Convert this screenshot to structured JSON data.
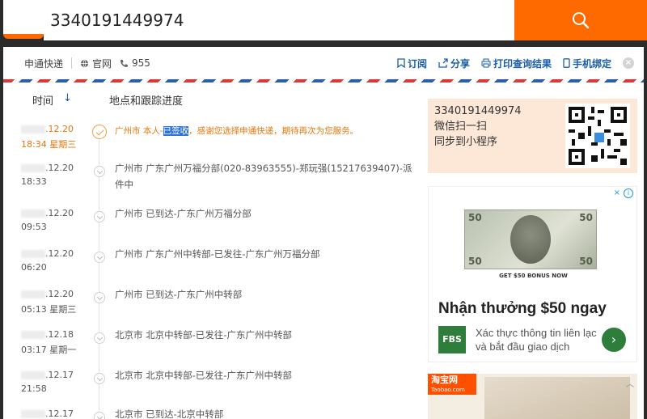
{
  "search": {
    "value": "3340191449974",
    "icon": "search-icon"
  },
  "toolbar": {
    "carrier": "申通快递",
    "website": "官网",
    "phone": "955",
    "actions": [
      {
        "label": "订阅",
        "icon": "bookmark-icon"
      },
      {
        "label": "分享",
        "icon": "share-icon"
      },
      {
        "label": "打印查询结果",
        "icon": "print-icon"
      },
      {
        "label": "手机绑定",
        "icon": "phone-icon"
      }
    ]
  },
  "timeline": {
    "header_time": "时间",
    "header_sort": "↓",
    "header_location": "地点和跟踪进度",
    "rows": [
      {
        "date": ".12.20",
        "time": "18:34 星期三",
        "status_prefix": "广州市 本人-",
        "status_highlight": "已签收",
        "status_suffix": "，感谢您选择申通快递，期待再次为您服务。"
      },
      {
        "date": ".12.20",
        "time": "18:33",
        "status": "广州市 广东广州万福分部(020-83963555)-郑玩强(15217639407)-派件中"
      },
      {
        "date": ".12.20",
        "time": "09:53",
        "status": "广州市 已到达-广东广州万福分部"
      },
      {
        "date": ".12.20",
        "time": "06:20",
        "status": "广州市 广东广州中转部-已发往-广东广州万福分部"
      },
      {
        "date": ".12.20",
        "time": "05:13  星期三",
        "status": "广州市 已到达-广东广州中转部"
      },
      {
        "date": ".12.18",
        "time": "03:17  星期一",
        "status": "北京市 北京中转部-已发往-广东广州中转部"
      },
      {
        "date": ".12.17",
        "time": "21:58",
        "status": "北京市 北京中转部-已发往-广东广州中转部"
      },
      {
        "date": ".12.17",
        "time": "",
        "status": "北京市 已到达-北京中转部"
      }
    ]
  },
  "mini_program": {
    "tracking": "3340191449974",
    "line1": "微信扫一扫",
    "line2": "同步到小程序"
  },
  "ad": {
    "bill_value": "50",
    "bonus": "GET $50 BONUS NOW",
    "headline": "Nhận thưởng $50 ngay",
    "brand": "FBS",
    "sub": "Xác thực thông tin liên lạc và bắt đầu giao dịch",
    "go": "›",
    "info": "i",
    "close": "×"
  },
  "ad2": {
    "brand": "淘宝网",
    "domain": "Taobao.com"
  },
  "colors": {
    "accent": "#ff6a00",
    "link": "#1a5ea8",
    "signed": "#e8760a"
  }
}
